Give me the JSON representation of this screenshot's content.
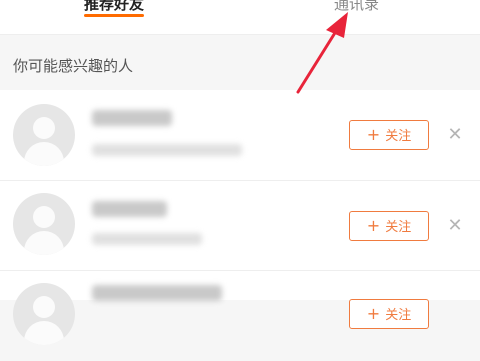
{
  "tabs": [
    {
      "label": "推荐好友"
    },
    {
      "label": "通讯录"
    }
  ],
  "section_title": "你可能感兴趣的人",
  "items": [
    {
      "follow_label": "关注"
    },
    {
      "follow_label": "关注"
    },
    {
      "follow_label": "关注"
    }
  ],
  "colors": {
    "accent": "#f07b3f",
    "annotation_arrow": "#e8243a"
  },
  "icons": {
    "plus": "plus-icon",
    "dismiss": "close-icon",
    "avatar": "default-avatar-icon"
  }
}
